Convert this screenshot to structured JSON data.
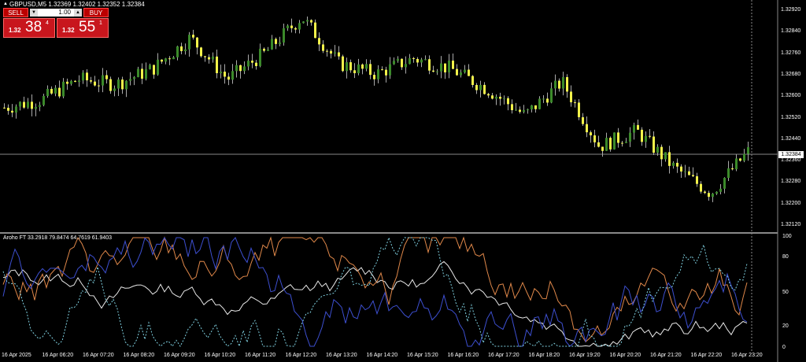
{
  "chart": {
    "title": "GBPUSD,M5  1.32369 1.32402 1.32352 1.32384",
    "current_price": "1.32384",
    "y_axis_labels": [
      "1.32920",
      "1.32840",
      "1.32760",
      "1.32680",
      "1.32600",
      "1.32520",
      "1.32440",
      "1.32360",
      "1.32280",
      "1.32200",
      "1.32120"
    ],
    "x_axis_labels": [
      "16 Apr 2025",
      "16 Apr 06:20",
      "16 Apr 07:20",
      "16 Apr 08:20",
      "16 Apr 09:20",
      "16 Apr 10:20",
      "16 Apr 11:20",
      "16 Apr 12:20",
      "16 Apr 13:20",
      "16 Apr 14:20",
      "16 Apr 15:20",
      "16 Apr 16:20",
      "16 Apr 17:20",
      "16 Apr 18:20",
      "16 Apr 19:20",
      "16 Apr 20:20",
      "16 Apr 21:20",
      "16 Apr 22:20",
      "16 Apr 23:20"
    ],
    "colors": {
      "bull": "#3b8a2a",
      "bear": "#f2f24a",
      "wick": "#aaaaaa",
      "background": "#000000"
    }
  },
  "trade_panel": {
    "sell_label": "SELL",
    "buy_label": "BUY",
    "lot_value": "1.00",
    "sell_price": {
      "prefix": "1.32",
      "big": "38",
      "sup": "4"
    },
    "buy_price": {
      "prefix": "1.32",
      "big": "55",
      "sup": "1"
    }
  },
  "indicator": {
    "title": "Aroho FT 33.2918 79.8474 64.7619 61.9403",
    "levels": [
      "100",
      "80",
      "50",
      "20",
      "0"
    ]
  },
  "chart_data": {
    "type": "line",
    "x": [
      0,
      1,
      2,
      3,
      4,
      5,
      6,
      7,
      8,
      9,
      10,
      11,
      12,
      13,
      14,
      15,
      16,
      17,
      18,
      19,
      20
    ],
    "series": [
      {
        "values": [
          1.3255,
          1.3258,
          1.3266,
          1.3264,
          1.327,
          1.3282,
          1.3266,
          1.3276,
          1.329,
          1.3272,
          1.3268,
          1.3274,
          1.327,
          1.3262,
          1.3252,
          1.3265,
          1.324,
          1.3246,
          1.3232,
          1.3222,
          1.3238
        ]
      }
    ],
    "xlim": [
      0,
      20
    ],
    "ylim": [
      1.321,
      1.3295
    ]
  }
}
